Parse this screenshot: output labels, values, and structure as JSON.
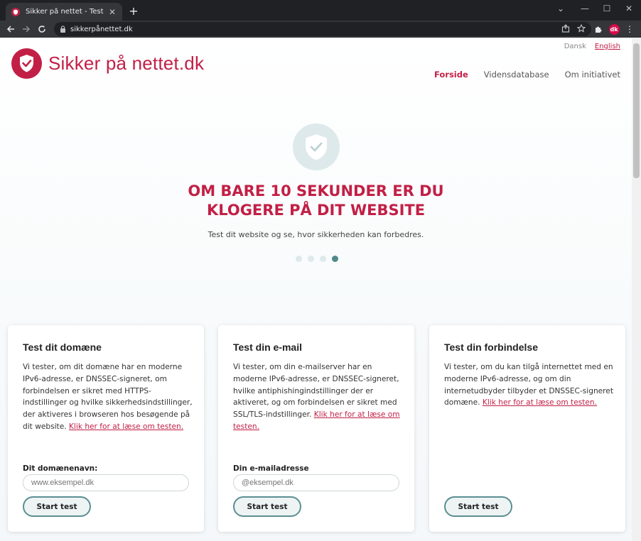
{
  "browser": {
    "tab_title": "Sikker på nettet - Test dit domæne",
    "url": "sikkerpånettet.dk",
    "profile_initials": "dk"
  },
  "site": {
    "logo_text": "Sikker på nettet.dk",
    "lang_da": "Dansk",
    "lang_en": "English",
    "nav": [
      "Forside",
      "Vidensdatabase",
      "Om initiativet"
    ],
    "brand_color": "#c21f46",
    "accent_color": "#4f8a8b"
  },
  "hero": {
    "title_line1": "OM BARE 10 SEKUNDER ER DU",
    "title_line2": "KLOGERE PÅ DIT WEBSITE",
    "subtitle": "Test dit website og se, hvor sikkerheden kan forbedres.",
    "slide_count": 4,
    "active_slide": 4
  },
  "cards": [
    {
      "title": "Test dit domæne",
      "desc": "Vi tester, om dit domæne har en moderne IPv6-adresse, er DNSSEC-signeret, om forbindelsen er sikret med HTTPS-indstillinger og hvilke sikkerhedsindstillinger, der aktiveres i browseren hos besøgende på dit website.",
      "link": "Klik her for at læse om testen.",
      "field_label": "Dit domænenavn:",
      "placeholder": "www.eksempel.dk",
      "button": "Start test"
    },
    {
      "title": "Test din e-mail",
      "desc": "Vi tester, om din e-mailserver har en moderne IPv6-adresse, er DNSSEC-signeret, hvilke antiphishingindstillinger der er aktiveret, og om forbindelsen er sikret med SSL/TLS-indstillinger.",
      "link": "Klik her for at læse om testen.",
      "field_label": "Din e-mailadresse",
      "placeholder": "@eksempel.dk",
      "button": "Start test"
    },
    {
      "title": "Test din forbindelse",
      "desc": "Vi tester, om du kan tilgå internettet med en moderne IPv6-adresse, og om din internetudbyder tilbyder et DNSSEC-signeret domæne.",
      "link": "Klik her for at læse om testen.",
      "button": "Start test"
    }
  ]
}
